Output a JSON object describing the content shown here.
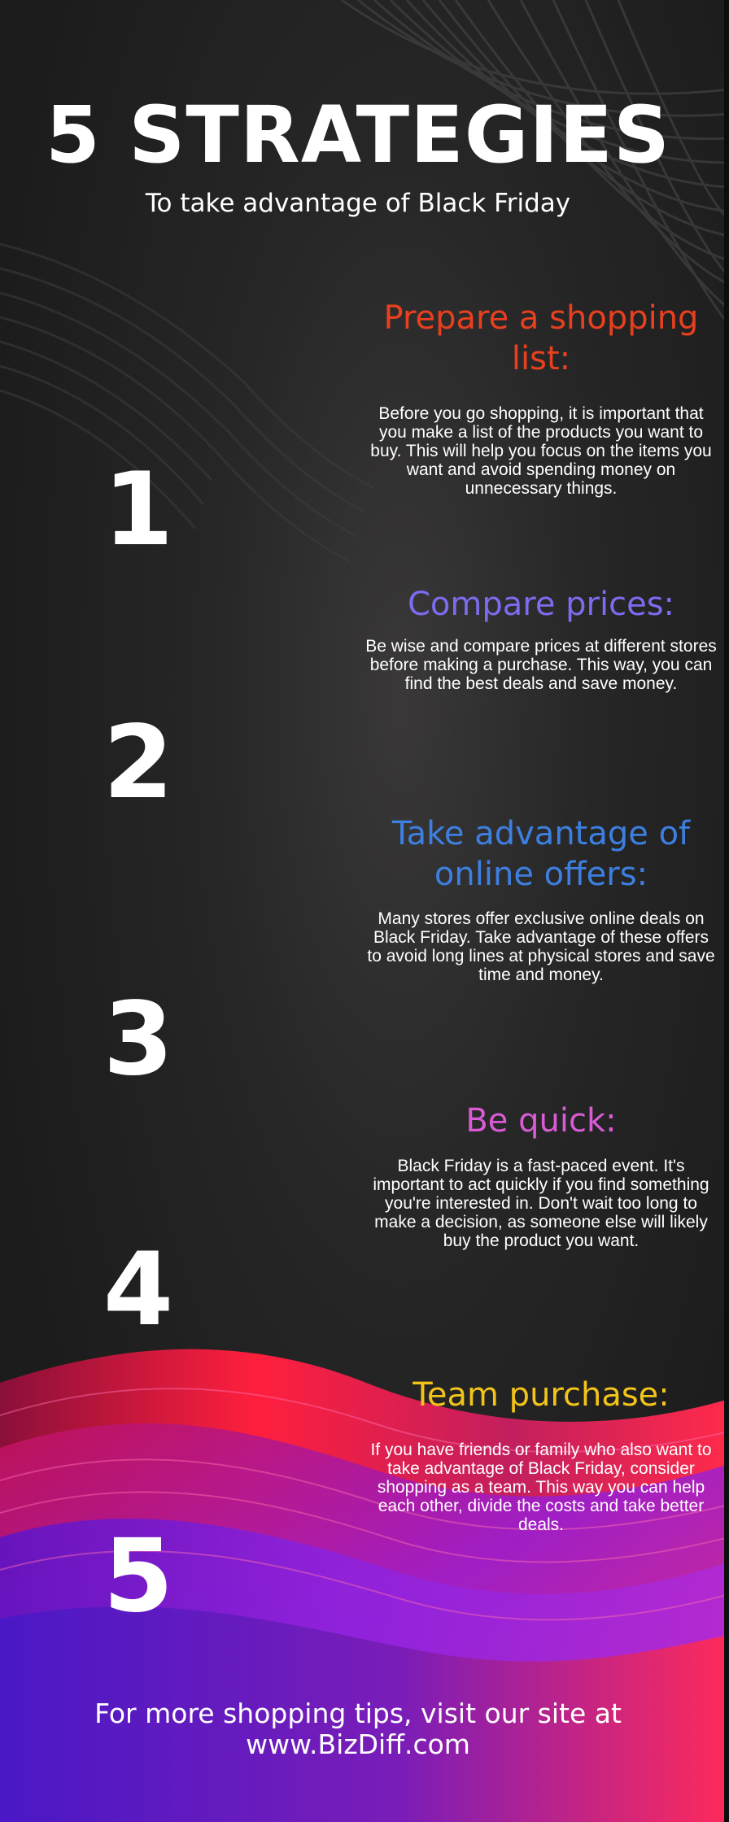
{
  "header": {
    "title": "5 STRATEGIES",
    "subtitle": "To take advantage of Black Friday"
  },
  "strategies": [
    {
      "number": "1",
      "heading": "Prepare a shopping list:",
      "text": "Before you go shopping, it is important that you make a list of the products you want to buy. This will help you focus on the items you want and avoid spending money on unnecessary things.",
      "color": "#e8401f"
    },
    {
      "number": "2",
      "heading": "Compare prices:",
      "text": "Be wise and compare prices at different stores before making a purchase. This way, you can find the best deals and save money.",
      "color": "#7b6cf0"
    },
    {
      "number": "3",
      "heading": "Take advantage of online offers:",
      "text": "Many stores offer exclusive online deals on Black Friday. Take advantage of these offers to avoid long lines at physical stores and save time and money.",
      "color": "#3d7fe0"
    },
    {
      "number": "4",
      "heading": "Be quick:",
      "text": "Black Friday is a fast-paced event. It's important to act quickly if you find something you're interested in. Don't wait too long to make a decision, as someone else will likely buy the product you want.",
      "color": "#d95bd6"
    },
    {
      "number": "5",
      "heading": "Team purchase:",
      "text": "If you have friends or family who also want to take advantage of Black Friday, consider shopping as a team. This way you can help each other, divide the costs and take better deals.",
      "color": "#f2c41a"
    }
  ],
  "footer": {
    "text": "For more shopping tips, visit our site at www.BizDiff.com"
  }
}
